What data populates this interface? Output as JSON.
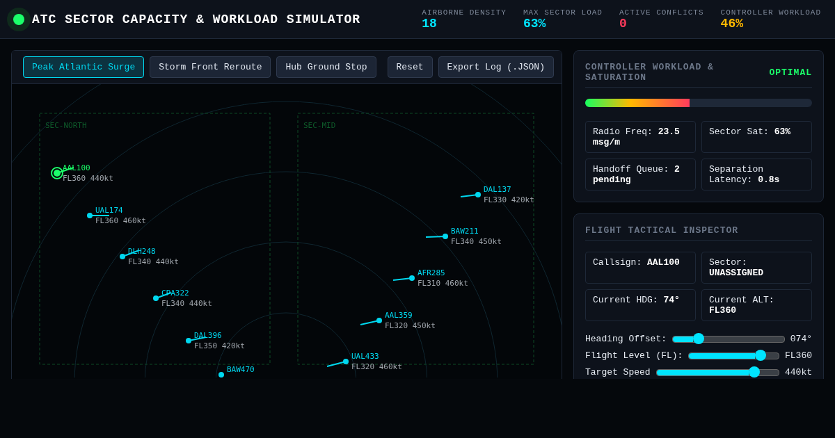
{
  "header": {
    "title": "ATC SECTOR CAPACITY & WORKLOAD SIMULATOR",
    "stats": [
      {
        "label": "AIRBORNE DENSITY",
        "value": "18",
        "color": "#00e5ff"
      },
      {
        "label": "MAX SECTOR LOAD",
        "value": "63%",
        "color": "#00e5ff"
      },
      {
        "label": "ACTIVE CONFLICTS",
        "value": "0",
        "color": "#ff3b5c"
      },
      {
        "label": "CONTROLLER WORKLOAD",
        "value": "46%",
        "color": "#ffb800"
      }
    ]
  },
  "scenarios": [
    {
      "label": "Peak Atlantic Surge",
      "selected": true
    },
    {
      "label": "Storm Front Reroute",
      "selected": false
    },
    {
      "label": "Hub Ground Stop",
      "selected": false
    }
  ],
  "actions": [
    "Reset",
    "Export Log (.JSON)"
  ],
  "map": {
    "sectors": [
      "SEC-NORTH",
      "SEC-MID"
    ],
    "aircraft": [
      {
        "callsign": "AAL100",
        "detail": "FL360 440kt",
        "selected": true
      },
      {
        "callsign": "UAL174",
        "detail": "FL360 460kt",
        "selected": false
      },
      {
        "callsign": "DLH248",
        "detail": "FL340 440kt",
        "selected": false
      },
      {
        "callsign": "CPA322",
        "detail": "FL340 440kt",
        "selected": false
      },
      {
        "callsign": "DAL396",
        "detail": "FL350 420kt",
        "selected": false
      },
      {
        "callsign": "BAW470",
        "selected": false
      },
      {
        "callsign": "DAL137",
        "detail": "FL330 420kt",
        "selected": false
      },
      {
        "callsign": "BAW211",
        "detail": "FL340 450kt",
        "selected": false
      },
      {
        "callsign": "AFR285",
        "detail": "FL310 460kt",
        "selected": false
      },
      {
        "callsign": "AAL359",
        "detail": "FL320 450kt",
        "selected": false
      },
      {
        "callsign": "UAL433",
        "detail": "FL320 460kt",
        "selected": false
      }
    ]
  },
  "workload": {
    "title": "CONTROLLER WORKLOAD & SATURATION",
    "status": "OPTIMAL",
    "level": 0.46,
    "metrics": [
      {
        "label": "Radio Freq:",
        "value": "23.5 msg/m"
      },
      {
        "label": "Sector Sat:",
        "value": "63%"
      },
      {
        "label": "Handoff Queue:",
        "value": "2 pending"
      },
      {
        "label": "Separation Latency:",
        "value": "0.8s"
      }
    ]
  },
  "inspector": {
    "title": "FLIGHT TACTICAL INSPECTOR",
    "fields": [
      {
        "label": "Callsign:",
        "value": "AAL100"
      },
      {
        "label": "Sector:",
        "value": "UNASSIGNED"
      },
      {
        "label": "Current HDG:",
        "value": "74°"
      },
      {
        "label": "Current ALT:",
        "value": "FL360"
      }
    ],
    "sliders": [
      {
        "label": "Heading Offset:",
        "level": 0.23,
        "reading": "074°"
      },
      {
        "label": "Flight Level (FL):",
        "level": 0.8,
        "reading": "FL360"
      },
      {
        "label": "Target Speed",
        "level": 0.8,
        "reading": "440kt"
      }
    ]
  }
}
